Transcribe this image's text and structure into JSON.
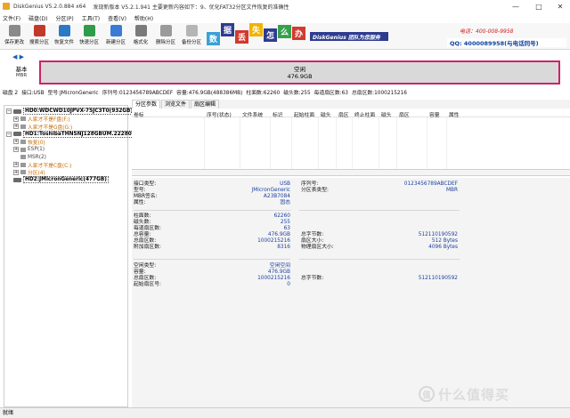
{
  "window": {
    "title": "DiskGenius V5.2.0.884 x64",
    "notice": "发现新版本 V5.2.1.941 主要更新内容如下：9、优化FAT32分区文件恢复的准确性"
  },
  "menu": [
    "文件(F)",
    "磁盘(D)",
    "分区(P)",
    "工具(T)",
    "查看(V)",
    "帮助(H)"
  ],
  "toolbar": [
    {
      "label": "保存更改",
      "icon": "save-icon",
      "color": "#8a8a8a"
    },
    {
      "label": "搜索分区",
      "icon": "search-partition-icon",
      "color": "#c0392b"
    },
    {
      "label": "恢复文件",
      "icon": "recover-file-icon",
      "color": "#2b78c5"
    },
    {
      "label": "快速分区",
      "icon": "quick-partition-icon",
      "color": "#2e9c4a"
    },
    {
      "label": "新建分区",
      "icon": "new-partition-icon",
      "color": "#3a7bd5"
    },
    {
      "label": "格式化",
      "icon": "format-icon",
      "color": "#7a7a7a"
    },
    {
      "label": "删除分区",
      "icon": "delete-partition-icon",
      "color": "#9a9a9a"
    },
    {
      "label": "备份分区",
      "icon": "backup-partition-icon",
      "color": "#b5b5b5"
    }
  ],
  "banner": {
    "tiles": [
      {
        "char": "数",
        "color": "#3aa0d8"
      },
      {
        "char": "据",
        "color": "#2e3c8f"
      },
      {
        "char": "丢",
        "color": "#d13a2f"
      },
      {
        "char": "失",
        "color": "#f0b400"
      },
      {
        "char": "怎",
        "color": "#2e3c8f"
      },
      {
        "char": "么",
        "color": "#35a14a"
      },
      {
        "char": "办",
        "color": "#d13a2f"
      }
    ],
    "brand": "DiskGenius 团队为您服务",
    "phone": "电话：400-008-9958",
    "qq": "QQ: 4000089958(与电话同号)"
  },
  "disk_nav": {
    "left_arrow": "◀",
    "right_arrow": "▶",
    "type": "基本",
    "scheme": "MBR"
  },
  "disk_bar": {
    "label": "空闲",
    "size": "476.9GB"
  },
  "disk_info": [
    "磁盘 2",
    "接口:USB",
    "型号:JMicronGeneric",
    "序列号:0123456789ABCDEF",
    "容量:476.9GB(488386MB)",
    "柱面数:62260",
    "磁头数:255",
    "每道扇区数:63",
    "总扇区数:1000215216"
  ],
  "tree": [
    {
      "text": "HD0:WDCWD10JPVX-75JC3T0(932GB)",
      "kind": "disk",
      "exp": "−",
      "indent": 0
    },
    {
      "text": "人家才不是F盘(F:)",
      "kind": "orange",
      "exp": "+",
      "indent": 1
    },
    {
      "text": "人家才不是G盘(G:)",
      "kind": "orange",
      "exp": "+",
      "indent": 1
    },
    {
      "text": "HD1:ToshibaTHNSNJ128GBUM.222801",
      "kind": "disk",
      "exp": "−",
      "indent": 0
    },
    {
      "text": "恢复(0)",
      "kind": "orange",
      "exp": "+",
      "indent": 1
    },
    {
      "text": "ESP(1)",
      "kind": "gray",
      "exp": "+",
      "indent": 1
    },
    {
      "text": "MSR(2)",
      "kind": "gray",
      "exp": "",
      "indent": 1
    },
    {
      "text": "人家才不是C盘(C:)",
      "kind": "orange",
      "exp": "+",
      "indent": 1
    },
    {
      "text": "分区(4)",
      "kind": "orange",
      "exp": "+",
      "indent": 1
    },
    {
      "text": "HD2:JMicronGeneric(477GB)",
      "kind": "disk",
      "exp": "",
      "indent": 0
    }
  ],
  "tabs": [
    "分区参数",
    "浏览文件",
    "扇区编辑"
  ],
  "columns": [
    "卷标",
    "序号(状态)",
    "文件系统",
    "标识",
    "起始柱面",
    "磁头",
    "扇区",
    "终止柱面",
    "磁头",
    "扇区",
    "容量",
    "属性"
  ],
  "details": {
    "block1_left": [
      {
        "label": "接口类型:",
        "value": "USB"
      },
      {
        "label": "型号:",
        "value": "JMicronGeneric"
      },
      {
        "label": "MBR签名:",
        "value": "A23B7084"
      },
      {
        "label": "属性:",
        "value": "固态"
      }
    ],
    "block1_right": [
      {
        "label": "序列号:",
        "value": "0123456789ABCDEF"
      },
      {
        "label": "分区表类型:",
        "value": "MBR"
      }
    ],
    "block2_left": [
      {
        "label": "柱面数:",
        "value": "62260"
      },
      {
        "label": "磁头数:",
        "value": "255"
      },
      {
        "label": "每道扇区数:",
        "value": "63"
      },
      {
        "label": "总容量:",
        "value": "476.9GB"
      },
      {
        "label": "总扇区数:",
        "value": "1000215216"
      },
      {
        "label": "附加扇区数:",
        "value": "8316"
      }
    ],
    "block2_right": [
      {
        "label": "总字节数:",
        "value": "512110190592"
      },
      {
        "label": "扇区大小:",
        "value": "512 Bytes"
      },
      {
        "label": "物理扇区大小:",
        "value": "4096 Bytes"
      }
    ],
    "block3_left": [
      {
        "label": "空闲类型:",
        "value": "空闲空间"
      },
      {
        "label": "容量:",
        "value": "476.9GB"
      },
      {
        "label": "总扇区数:",
        "value": "1000215216"
      },
      {
        "label": "起始扇区号:",
        "value": "0"
      }
    ],
    "block3_right": [
      {
        "label": "总字节数:",
        "value": "512110190592"
      }
    ]
  },
  "status": "就绪",
  "watermark": {
    "symbol": "值",
    "text": "什么值得买"
  }
}
